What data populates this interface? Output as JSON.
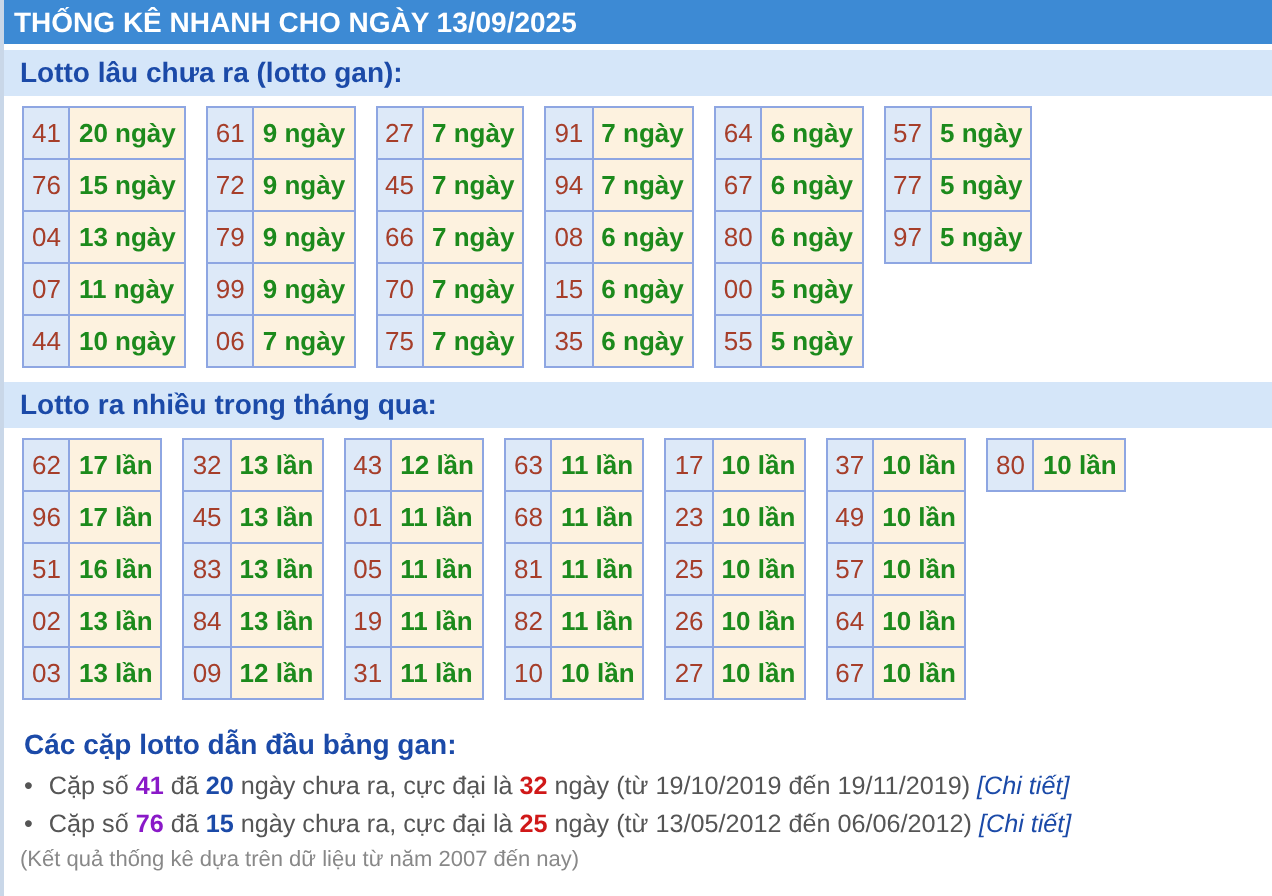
{
  "title": "THỐNG KÊ NHANH CHO NGÀY 13/09/2025",
  "sections": [
    {
      "heading": "Lotto lâu chưa ra (lotto gan):",
      "groups": [
        [
          [
            "41",
            "20 ngày"
          ],
          [
            "76",
            "15 ngày"
          ],
          [
            "04",
            "13 ngày"
          ],
          [
            "07",
            "11 ngày"
          ],
          [
            "44",
            "10 ngày"
          ]
        ],
        [
          [
            "61",
            "9 ngày"
          ],
          [
            "72",
            "9 ngày"
          ],
          [
            "79",
            "9 ngày"
          ],
          [
            "99",
            "9 ngày"
          ],
          [
            "06",
            "7 ngày"
          ]
        ],
        [
          [
            "27",
            "7 ngày"
          ],
          [
            "45",
            "7 ngày"
          ],
          [
            "66",
            "7 ngày"
          ],
          [
            "70",
            "7 ngày"
          ],
          [
            "75",
            "7 ngày"
          ]
        ],
        [
          [
            "91",
            "7 ngày"
          ],
          [
            "94",
            "7 ngày"
          ],
          [
            "08",
            "6 ngày"
          ],
          [
            "15",
            "6 ngày"
          ],
          [
            "35",
            "6 ngày"
          ]
        ],
        [
          [
            "64",
            "6 ngày"
          ],
          [
            "67",
            "6 ngày"
          ],
          [
            "80",
            "6 ngày"
          ],
          [
            "00",
            "5 ngày"
          ],
          [
            "55",
            "5 ngày"
          ]
        ],
        [
          [
            "57",
            "5 ngày"
          ],
          [
            "77",
            "5 ngày"
          ],
          [
            "97",
            "5 ngày"
          ]
        ]
      ]
    },
    {
      "heading": "Lotto ra nhiều trong tháng qua:",
      "groups": [
        [
          [
            "62",
            "17 lần"
          ],
          [
            "96",
            "17 lần"
          ],
          [
            "51",
            "16 lần"
          ],
          [
            "02",
            "13 lần"
          ],
          [
            "03",
            "13 lần"
          ]
        ],
        [
          [
            "32",
            "13 lần"
          ],
          [
            "45",
            "13 lần"
          ],
          [
            "83",
            "13 lần"
          ],
          [
            "84",
            "13 lần"
          ],
          [
            "09",
            "12 lần"
          ]
        ],
        [
          [
            "43",
            "12 lần"
          ],
          [
            "01",
            "11 lần"
          ],
          [
            "05",
            "11 lần"
          ],
          [
            "19",
            "11 lần"
          ],
          [
            "31",
            "11 lần"
          ]
        ],
        [
          [
            "63",
            "11 lần"
          ],
          [
            "68",
            "11 lần"
          ],
          [
            "81",
            "11 lần"
          ],
          [
            "82",
            "11 lần"
          ],
          [
            "10",
            "10 lần"
          ]
        ],
        [
          [
            "17",
            "10 lần"
          ],
          [
            "23",
            "10 lần"
          ],
          [
            "25",
            "10 lần"
          ],
          [
            "26",
            "10 lần"
          ],
          [
            "27",
            "10 lần"
          ]
        ],
        [
          [
            "37",
            "10 lần"
          ],
          [
            "49",
            "10 lần"
          ],
          [
            "57",
            "10 lần"
          ],
          [
            "64",
            "10 lần"
          ],
          [
            "67",
            "10 lần"
          ]
        ],
        [
          [
            "80",
            "10 lần"
          ]
        ]
      ]
    }
  ],
  "leaders": {
    "heading": "Các cặp lotto dẫn đầu bảng gan:",
    "items": [
      {
        "bullet": "•",
        "parts": [
          {
            "kind": "plain",
            "text": "Cặp số "
          },
          {
            "kind": "pair",
            "text": "41"
          },
          {
            "kind": "plain",
            "text": " đã "
          },
          {
            "kind": "days",
            "text": "20"
          },
          {
            "kind": "plain",
            "text": " ngày chưa ra, cực đại là "
          },
          {
            "kind": "max",
            "text": "32"
          },
          {
            "kind": "plain",
            "text": " ngày (từ 19/10/2019 đến 19/11/2019) "
          }
        ],
        "link": "[Chi tiết]"
      },
      {
        "bullet": "•",
        "parts": [
          {
            "kind": "plain",
            "text": "Cặp số "
          },
          {
            "kind": "pair",
            "text": "76"
          },
          {
            "kind": "plain",
            "text": " đã "
          },
          {
            "kind": "days",
            "text": "15"
          },
          {
            "kind": "plain",
            "text": " ngày chưa ra, cực đại là "
          },
          {
            "kind": "max",
            "text": "25"
          },
          {
            "kind": "plain",
            "text": " ngày (từ 13/05/2012 đến 06/06/2012) "
          }
        ],
        "link": "[Chi tiết]"
      }
    ],
    "note": "(Kết quả thống kê dựa trên dữ liệu từ năm 2007 đến nay)"
  }
}
